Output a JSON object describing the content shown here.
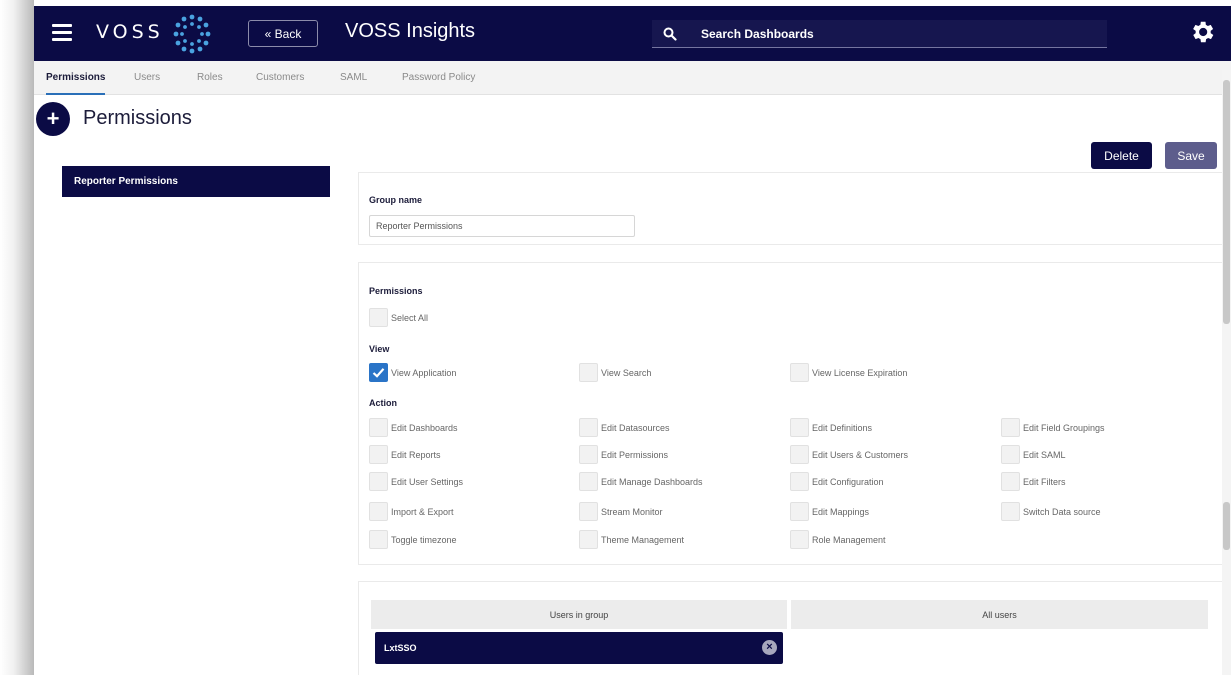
{
  "topbar": {
    "menu_icon": "hamburger-menu-icon",
    "brand": "VOSS",
    "logo_icon": "voss-dots-logo",
    "back_label": "« Back",
    "title": "VOSS Insights",
    "search_placeholder": "Search Dashboards",
    "settings_icon": "gear-icon",
    "colors": {
      "bar": "#0b0b45",
      "accent": "#2a74c7"
    }
  },
  "tabs": [
    {
      "label": "Permissions",
      "active": true
    },
    {
      "label": "Users"
    },
    {
      "label": "Roles"
    },
    {
      "label": "Customers"
    },
    {
      "label": "SAML"
    },
    {
      "label": "Password Policy"
    }
  ],
  "page": {
    "title": "Permissions",
    "add_icon": "plus-icon"
  },
  "left_list": {
    "items": [
      "Reporter Permissions"
    ]
  },
  "actions": {
    "delete": "Delete",
    "save": "Save"
  },
  "group": {
    "label": "Group name",
    "value": "Reporter Permissions"
  },
  "permissions": {
    "heading": "Permissions",
    "select_all": "Select All",
    "view_heading": "View",
    "view": [
      {
        "label": "View Application",
        "checked": true
      },
      {
        "label": "View Search",
        "checked": false
      },
      {
        "label": "View License Expiration",
        "checked": false
      }
    ],
    "action_heading": "Action",
    "action_rows": [
      [
        "Edit Dashboards",
        "Edit Datasources",
        "Edit Definitions",
        "Edit Field Groupings"
      ],
      [
        "Edit Reports",
        "Edit Permissions",
        "Edit Users & Customers",
        "Edit SAML"
      ],
      [
        "Edit User Settings",
        "Edit Manage Dashboards",
        "Edit Configuration",
        "Edit Filters"
      ],
      [
        "Import & Export",
        "Stream Monitor",
        "Edit Mappings",
        "Switch Data source"
      ],
      [
        "Toggle timezone",
        "Theme Management",
        "Role Management"
      ]
    ]
  },
  "users": {
    "in_group_header": "Users in group",
    "all_users_header": "All users",
    "members": [
      "LxtSSO"
    ],
    "remove_icon": "close-circle-icon"
  }
}
